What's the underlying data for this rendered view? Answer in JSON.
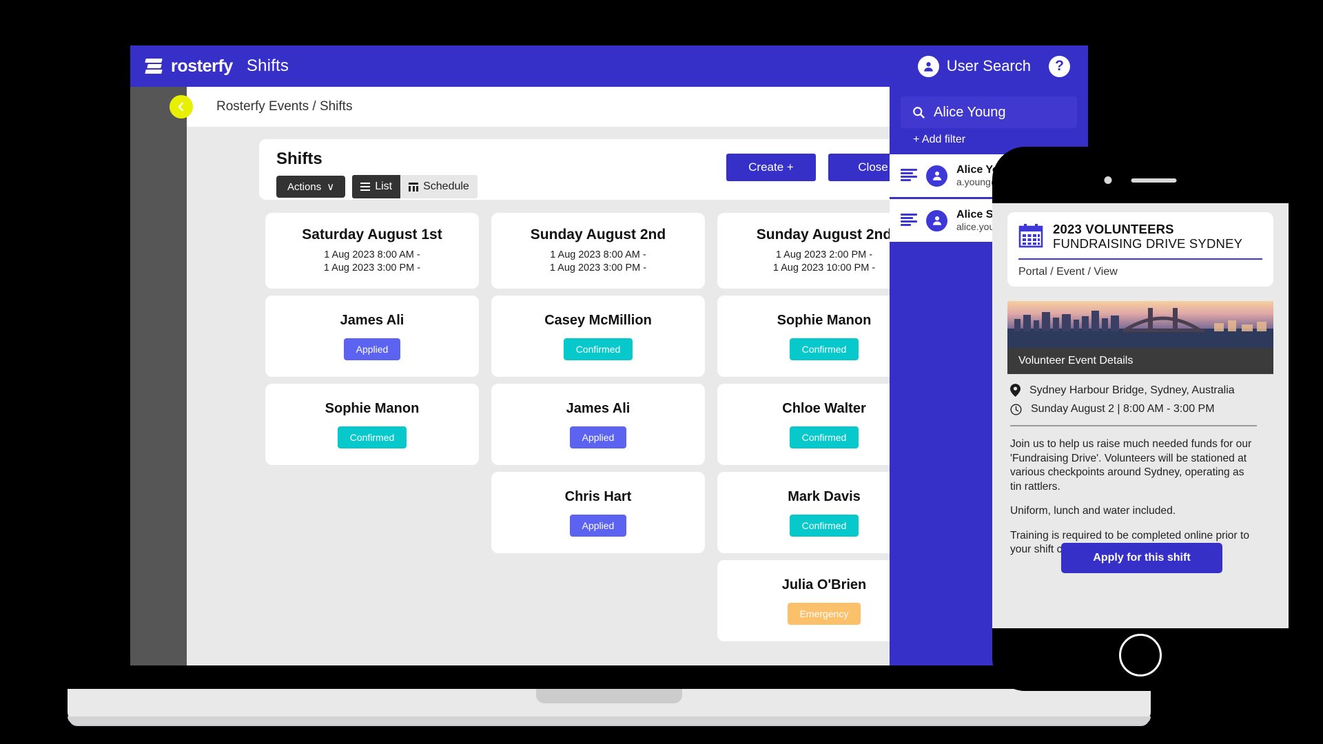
{
  "app": {
    "brand": "rosterfy",
    "page_title": "Shifts",
    "user_search_label": "User Search",
    "help_label": "?",
    "breadcrumb": "Rosterfy Events / Shifts"
  },
  "panel": {
    "title": "Shifts",
    "actions_label": "Actions",
    "actions_caret": "∨",
    "view_list": "List",
    "view_schedule": "Schedule",
    "create_label": "Create +",
    "close_label": "Close"
  },
  "columns": [
    {
      "date": {
        "name": "Saturday August 1st",
        "start": "1 Aug 2023 8:00 AM -",
        "end": "1 Aug 2023 3:00 PM -"
      },
      "volunteers": [
        {
          "name": "James Ali",
          "status": "Applied",
          "status_kind": "applied"
        },
        {
          "name": "Sophie Manon",
          "status": "Confirmed",
          "status_kind": "confirmed"
        }
      ]
    },
    {
      "date": {
        "name": "Sunday August 2nd",
        "start": "1 Aug 2023 8:00 AM -",
        "end": "1 Aug 2023 3:00 PM -"
      },
      "volunteers": [
        {
          "name": "Casey McMillion",
          "status": "Confirmed",
          "status_kind": "confirmed"
        },
        {
          "name": "James Ali",
          "status": "Applied",
          "status_kind": "applied"
        },
        {
          "name": "Chris Hart",
          "status": "Applied",
          "status_kind": "applied"
        }
      ]
    },
    {
      "date": {
        "name": "Sunday August 2nd",
        "start": "1 Aug 2023 2:00 PM -",
        "end": "1 Aug 2023 10:00 PM -"
      },
      "volunteers": [
        {
          "name": "Sophie Manon",
          "status": "Confirmed",
          "status_kind": "confirmed"
        },
        {
          "name": "Chloe Walter",
          "status": "Confirmed",
          "status_kind": "confirmed"
        },
        {
          "name": "Mark Davis",
          "status": "Confirmed",
          "status_kind": "confirmed"
        },
        {
          "name": "Julia O'Brien",
          "status": "Emergency",
          "status_kind": "emergency"
        }
      ]
    }
  ],
  "search": {
    "value": "Alice Young",
    "add_filter": "+ Add filter",
    "results": [
      {
        "name": "Alice Young",
        "email": "a.young@"
      },
      {
        "name": "Alice S Young",
        "email": "alice.young"
      }
    ]
  },
  "phone": {
    "event_line1": "2023 VOLUNTEERS",
    "event_line2": "FUNDRAISING DRIVE SYDNEY",
    "breadcrumb": "Portal / Event / View",
    "section_title": "Volunteer Event Details",
    "location": "Sydney Harbour Bridge, Sydney, Australia",
    "datetime": "Sunday August 2 | 8:00 AM - 3:00 PM",
    "paragraphs": [
      "Join us to help us raise much needed funds for our 'Fundraising Drive'. Volunteers will be stationed at various checkpoints around Sydney, operating as tin rattlers.",
      "Uniform, lunch and water included.",
      "Training is required to be completed online prior to your shift commencing."
    ],
    "apply_label": "Apply for this shift"
  },
  "colors": {
    "brand_blue": "#3730c8",
    "accent_yellow": "#e8f000",
    "applied": "#5b63f0",
    "confirmed": "#07c9cb",
    "emergency": "#fbc06a",
    "dark": "#333333"
  }
}
